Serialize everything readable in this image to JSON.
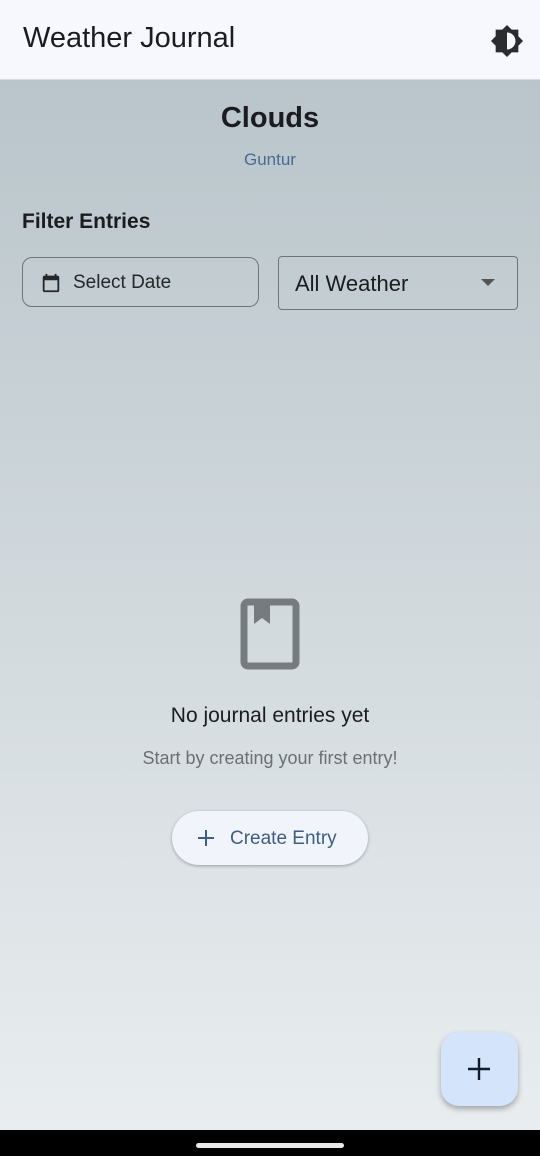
{
  "appbar": {
    "title": "Weather Journal",
    "theme_icon": "brightness-icon"
  },
  "weather": {
    "condition": "Clouds",
    "city": "Guntur"
  },
  "filters": {
    "heading": "Filter Entries",
    "date_label": "Select Date",
    "weather_selected": "All Weather"
  },
  "empty_state": {
    "title": "No journal entries yet",
    "subtitle": "Start by creating your first entry!",
    "button_label": "Create Entry"
  },
  "colors": {
    "accent": "#3c5d86",
    "fab": "#d4e4fb"
  }
}
